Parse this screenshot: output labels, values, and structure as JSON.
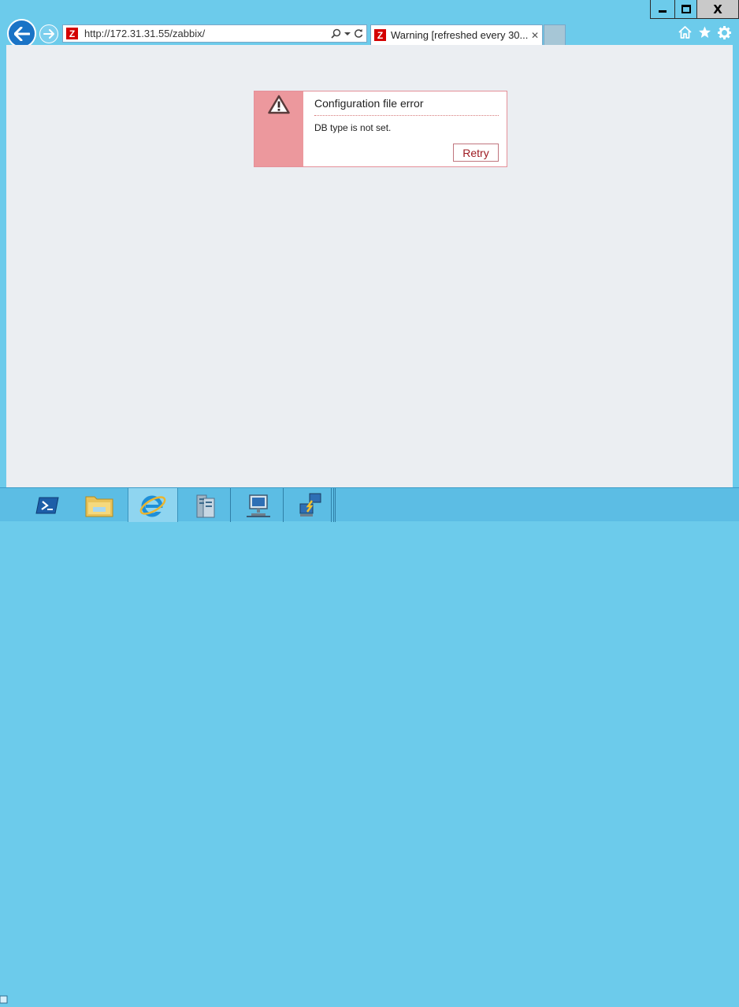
{
  "browser": {
    "address_url": "http://172.31.31.55/zabbix/",
    "tab_title": "Warning [refreshed every 30...",
    "tab_close": "✕",
    "favicon_letter": "Z",
    "window_controls": {
      "close": "X"
    }
  },
  "error": {
    "title": "Configuration file error",
    "message": "DB type is not set.",
    "retry_label": "Retry"
  },
  "icons": [
    "back-arrow-icon",
    "forward-arrow-icon",
    "search-icon",
    "dropdown-icon",
    "refresh-icon",
    "home-icon",
    "favorites-star-icon",
    "settings-gear-icon",
    "warning-triangle-icon",
    "powershell-icon",
    "file-explorer-icon",
    "internet-explorer-icon",
    "server-manager-icon",
    "network-computer-icon",
    "remote-desktop-icon"
  ],
  "colors": {
    "chrome": "#6ccbeb",
    "error_accent": "#ec989d",
    "retry_text": "#9e1b22",
    "favicon": "#d40000"
  }
}
